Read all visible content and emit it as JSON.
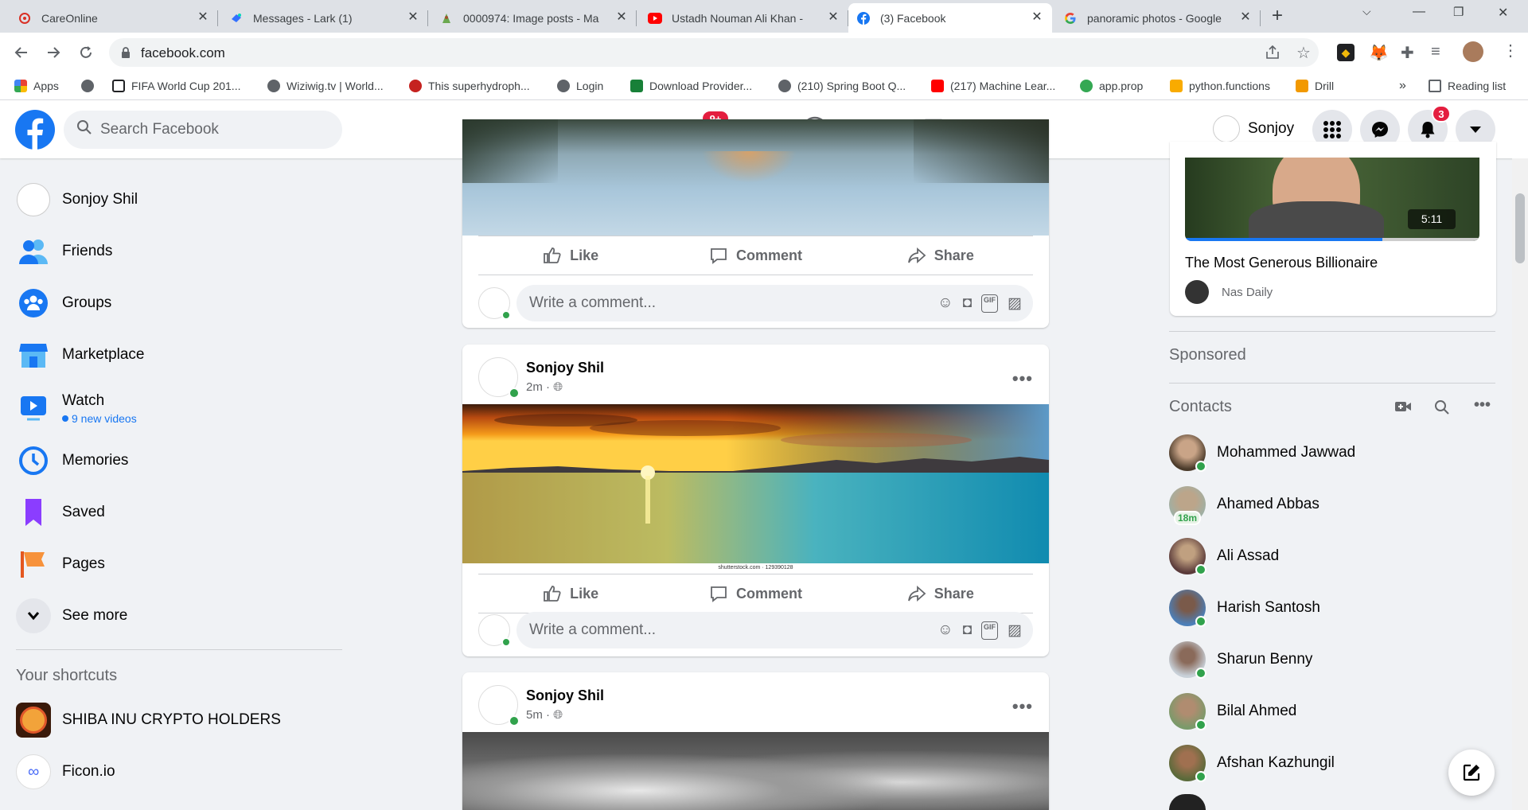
{
  "browser": {
    "tabs": [
      {
        "title": "CareOnline",
        "icon": "care-icon"
      },
      {
        "title": "Messages - Lark (1)",
        "icon": "lark-icon"
      },
      {
        "title": "0000974: Image posts - Ma",
        "icon": "mantis-icon"
      },
      {
        "title": "Ustadh Nouman Ali Khan -",
        "icon": "youtube-icon"
      },
      {
        "title": "(3) Facebook",
        "icon": "facebook-icon"
      },
      {
        "title": "panoramic photos - Google",
        "icon": "google-icon"
      }
    ],
    "new_tab": "+",
    "url": "facebook.com",
    "bookmarks": [
      {
        "label": "Apps",
        "color": "#ea4335"
      },
      {
        "label": "",
        "color": "#5f6368"
      },
      {
        "label": "FIFA World Cup 201...",
        "color": "#202124"
      },
      {
        "label": "Wiziwig.tv | World...",
        "color": "#5f6368"
      },
      {
        "label": "This superhydroph...",
        "color": "#c5221f"
      },
      {
        "label": "Login",
        "color": "#5f6368"
      },
      {
        "label": "Download Provider...",
        "color": "#188038"
      },
      {
        "label": "(210) Spring Boot Q...",
        "color": "#5f6368"
      },
      {
        "label": "(217) Machine Lear...",
        "color": "#ff0000"
      },
      {
        "label": "app.prop",
        "color": "#34a853"
      },
      {
        "label": "python.functions",
        "color": "#f9ab00"
      },
      {
        "label": "Drill",
        "color": "#f29900"
      }
    ],
    "more_bookmarks": "»",
    "reading_list": "Reading list"
  },
  "header": {
    "search_placeholder": "Search Facebook",
    "watch_badge": "9+",
    "notif_badge": "3",
    "profile_name": "Sonjoy"
  },
  "sidebar": {
    "items": [
      {
        "label": "Sonjoy Shil",
        "icon": "avatar"
      },
      {
        "label": "Friends",
        "icon": "friends-icon"
      },
      {
        "label": "Groups",
        "icon": "groups-icon"
      },
      {
        "label": "Marketplace",
        "icon": "marketplace-icon"
      },
      {
        "label": "Watch",
        "icon": "watch-icon",
        "sub": "9 new videos"
      },
      {
        "label": "Memories",
        "icon": "memories-icon"
      },
      {
        "label": "Saved",
        "icon": "saved-icon"
      },
      {
        "label": "Pages",
        "icon": "pages-icon"
      },
      {
        "label": "See more",
        "icon": "chevron-down-icon"
      }
    ],
    "shortcuts_title": "Your shortcuts",
    "shortcuts": [
      {
        "label": "SHIBA INU CRYPTO HOLDERS"
      },
      {
        "label": "Ficon.io"
      }
    ]
  },
  "feed": {
    "actions": {
      "like": "Like",
      "comment": "Comment",
      "share": "Share"
    },
    "comment_placeholder": "Write a comment...",
    "posts": [
      {
        "author": "Sonjoy Shil",
        "time": "2m ·",
        "watermark": "shutterstock.com · 129390128"
      },
      {
        "author": "Sonjoy Shil",
        "time": "5m ·"
      }
    ]
  },
  "right": {
    "video": {
      "title": "The Most Generous Billionaire",
      "duration": "5:11",
      "channel": "Nas Daily",
      "progress": 0.67
    },
    "sponsored_title": "Sponsored",
    "contacts_title": "Contacts",
    "contacts": [
      {
        "name": "Mohammed Jawwad",
        "online": true
      },
      {
        "name": "Ahamed Abbas",
        "online": false,
        "badge": "18m"
      },
      {
        "name": "Ali Assad",
        "online": true
      },
      {
        "name": "Harish Santosh",
        "online": true
      },
      {
        "name": "Sharun Benny",
        "online": true
      },
      {
        "name": "Bilal Ahmed",
        "online": true
      },
      {
        "name": "Afshan Kazhungil",
        "online": true
      }
    ]
  },
  "colors": {
    "fb_blue": "#1877f2",
    "online": "#31a24c",
    "badge_red": "#e41e3f"
  }
}
